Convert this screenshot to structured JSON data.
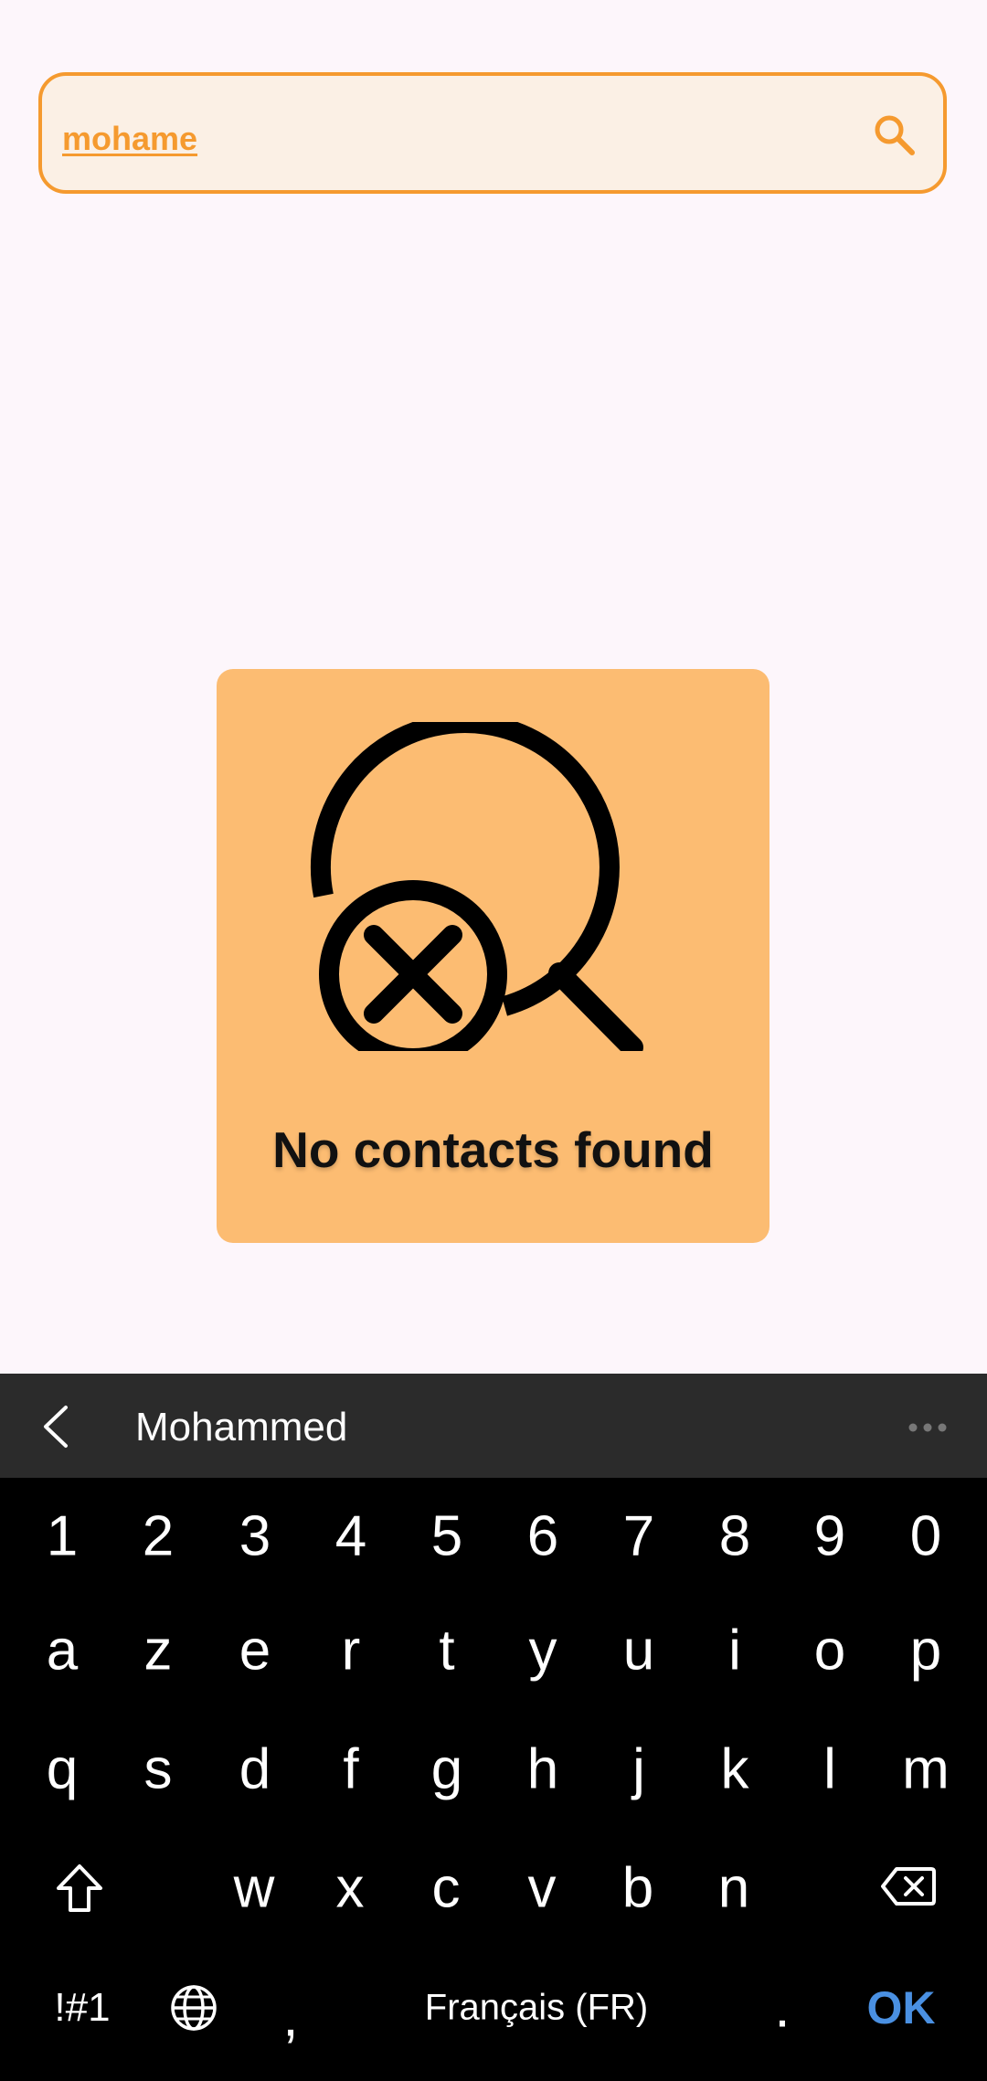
{
  "search": {
    "query": "mohame",
    "icon": "search-icon",
    "accent_color": "#f59a2f"
  },
  "empty_state": {
    "icon": "search-off-icon",
    "message": "No contacts found",
    "card_color": "#fcbc72"
  },
  "keyboard": {
    "suggestion": "Mohammed",
    "number_row": [
      "1",
      "2",
      "3",
      "4",
      "5",
      "6",
      "7",
      "8",
      "9",
      "0"
    ],
    "row1": [
      "a",
      "z",
      "e",
      "r",
      "t",
      "y",
      "u",
      "i",
      "o",
      "p"
    ],
    "row2": [
      "q",
      "s",
      "d",
      "f",
      "g",
      "h",
      "j",
      "k",
      "l",
      "m"
    ],
    "row3": [
      "w",
      "x",
      "c",
      "v",
      "b",
      "n"
    ],
    "symbols_label": "!#1",
    "comma_label": ",",
    "space_label": "Français (FR)",
    "period_label": ".",
    "ok_label": "OK",
    "ok_color": "#4a90e2"
  }
}
